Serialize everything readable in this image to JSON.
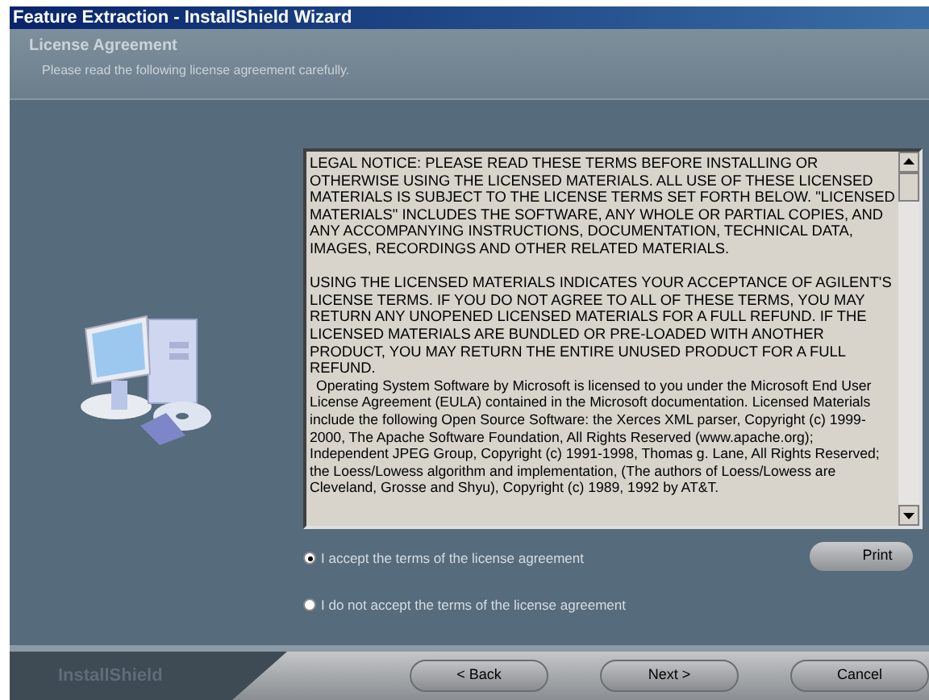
{
  "window": {
    "title": "Feature Extraction - InstallShield Wizard"
  },
  "header": {
    "title": "License Agreement",
    "subtitle": "Please read the following license agreement carefully."
  },
  "license_text": [
    "LEGAL NOTICE: PLEASE READ THESE TERMS BEFORE INSTALLING OR OTHERWISE USING THE LICENSED MATERIALS.  ALL USE OF THESE LICENSED MATERIALS IS SUBJECT TO THE LICENSE TERMS SET FORTH BELOW.  \"LICENSED MATERIALS\" INCLUDES THE SOFTWARE, ANY WHOLE OR PARTIAL COPIES, AND ANY ACCOMPANYING INSTRUCTIONS, DOCUMENTATION, TECHNICAL DATA, IMAGES, RECORDINGS AND OTHER RELATED MATERIALS.",
    "USING THE LICENSED MATERIALS INDICATES YOUR ACCEPTANCE OF AGILENT'S LICENSE TERMS.  IF YOU DO NOT AGREE TO ALL OF THESE TERMS, YOU MAY RETURN ANY UNOPENED LICENSED MATERIALS FOR A FULL REFUND.  IF THE LICENSED MATERIALS ARE BUNDLED OR PRE-LOADED WITH ANOTHER PRODUCT, YOU MAY RETURN THE ENTIRE UNUSED PRODUCT FOR A FULL REFUND.",
    "Operating System Software by Microsoft is licensed to you under the Microsoft End User License Agreement (EULA) contained in the Microsoft documentation. Licensed Materials include the following Open Source Software: the Xerces XML parser, Copyright (c) 1999-2000, The Apache Software Foundation, All Rights Reserved (www.apache.org); Independent JPEG Group, Copyright (c) 1991-1998, Thomas g. Lane, All Rights Reserved; the Loess/Lowess algorithm and implementation, (The authors of Loess/Lowess are Cleveland, Grosse and Shyu), Copyright (c) 1989, 1992 by AT&T."
  ],
  "options": [
    {
      "label": "I accept the terms of the license agreement",
      "selected": true
    },
    {
      "label": "I do not accept the terms of the license agreement",
      "selected": false
    }
  ],
  "print_button": "Print",
  "brand": "InstallShield",
  "buttons": [
    {
      "label": "< Back"
    },
    {
      "label": "Next >"
    },
    {
      "label": "Cancel"
    }
  ]
}
